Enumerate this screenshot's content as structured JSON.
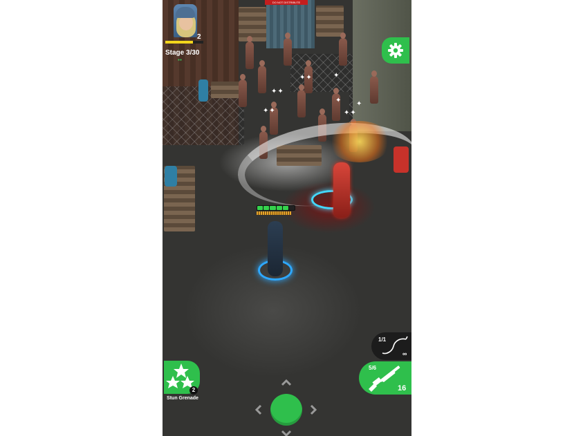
{
  "hud": {
    "player_level": "2",
    "xp_progress": 0.73,
    "stage_text": "Stage 3/30",
    "watermark": "DO NOT DISTRIBUTE",
    "settings_icon": "gear-icon"
  },
  "hero": {
    "health_segments_filled": 5,
    "health_segments_total": 6
  },
  "controls": {
    "skill": {
      "label": "Stun Grenade",
      "count": "2",
      "icon": "stars-icon"
    },
    "joystick": {
      "icons": [
        "chevron-up-icon",
        "chevron-left-icon",
        "chevron-right-icon",
        "chevron-down-icon"
      ]
    },
    "primary_weapon": {
      "ammo": "5/6",
      "reserve": "16",
      "icon": "shotgun-icon"
    },
    "secondary_weapon": {
      "ammo": "1/1",
      "reserve": "∞",
      "icon": "whip-icon"
    }
  },
  "colors": {
    "accent_green": "#2fbf4c",
    "xp_yellow": "#f3d51c",
    "ring_blue": "#2ea8ff",
    "watermark_red": "#c41e1e"
  }
}
